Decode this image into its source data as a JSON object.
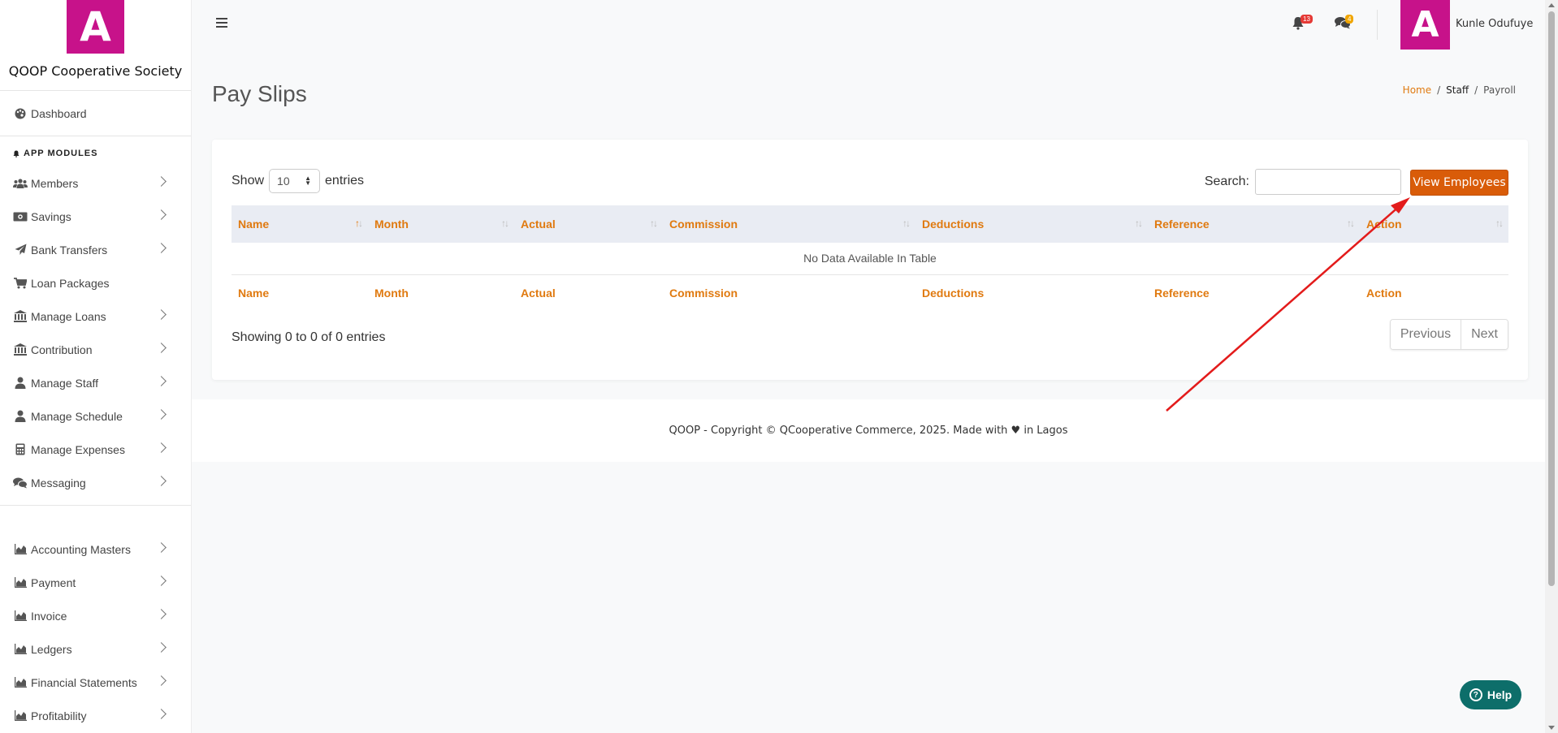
{
  "brand": {
    "logo_letter": "A",
    "name": "QOOP Cooperative Society",
    "color": "#c7128a"
  },
  "sidebar": {
    "dashboard": {
      "label": "Dashboard",
      "icon": "palette-icon"
    },
    "section_label": "APP MODULES",
    "modules": [
      {
        "label": "Members",
        "icon": "users-icon"
      },
      {
        "label": "Savings",
        "icon": "money-icon"
      },
      {
        "label": "Bank Transfers",
        "icon": "paper-plane-icon"
      },
      {
        "label": "Loan Packages",
        "icon": "cart-icon"
      },
      {
        "label": "Manage Loans",
        "icon": "bank-icon"
      },
      {
        "label": "Contribution",
        "icon": "bank-icon"
      },
      {
        "label": "Manage Staff",
        "icon": "user-icon"
      },
      {
        "label": "Manage Schedule",
        "icon": "user-icon"
      },
      {
        "label": "Manage Expenses",
        "icon": "calculator-icon"
      },
      {
        "label": "Messaging",
        "icon": "comments-icon"
      }
    ],
    "accounting": [
      {
        "label": "Accounting Masters",
        "icon": "chart-area-icon"
      },
      {
        "label": "Payment",
        "icon": "chart-area-icon"
      },
      {
        "label": "Invoice",
        "icon": "chart-area-icon"
      },
      {
        "label": "Ledgers",
        "icon": "chart-area-icon"
      },
      {
        "label": "Financial Statements",
        "icon": "chart-area-icon"
      },
      {
        "label": "Profitability",
        "icon": "chart-area-icon"
      }
    ]
  },
  "topbar": {
    "notifications_count": "13",
    "messages_count": "4",
    "avatar_letter": "A",
    "user_name": "Kunle Odufuye"
  },
  "page": {
    "title": "Pay Slips",
    "breadcrumb": {
      "home": "Home",
      "section": "Staff",
      "current": "Payroll"
    }
  },
  "table": {
    "show_label": "Show",
    "entries_value": "10",
    "entries_label": "entries",
    "search_label": "Search:",
    "search_value": "",
    "view_button": "View Employees",
    "columns": [
      "Name",
      "Month",
      "Actual",
      "Commission",
      "Deductions",
      "Reference",
      "Action"
    ],
    "empty_message": "No Data Available In Table",
    "info": "Showing 0 to 0 of 0 entries",
    "pager": {
      "previous": "Previous",
      "next": "Next"
    }
  },
  "footer": {
    "text": "QOOP - Copyright © QCooperative Commerce, 2025. Made with ♥ in Lagos"
  },
  "help": {
    "label": "Help"
  },
  "colors": {
    "accent": "#e07a10",
    "button": "#d95c09",
    "help": "#0d6e6a",
    "annotation_arrow": "#e31b1b"
  }
}
